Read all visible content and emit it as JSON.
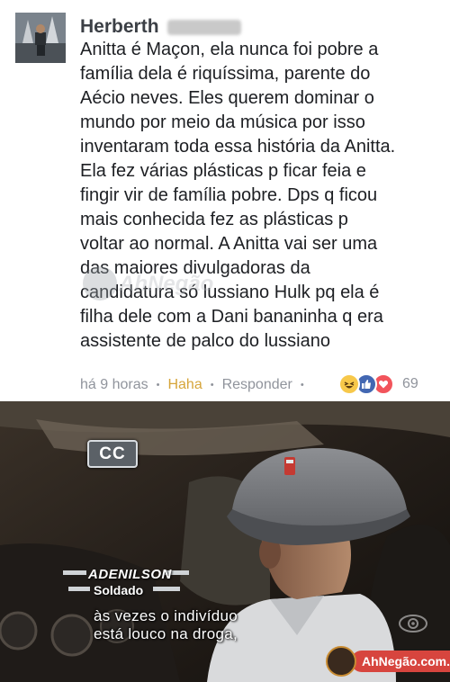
{
  "comment": {
    "author_name": "Herberth",
    "body": "Anitta é Maçon, ela nunca foi pobre a\nfamília dela é riquíssima, parente do\nAécio neves. Eles querem dominar o\nmundo por meio da música por isso\ninventaram toda essa história da Anitta.\nEla fez várias plásticas p ficar feia e\nfingir vir de família pobre. Dps q ficou\nmais conhecida fez as plásticas p\nvoltar ao normal. A Anitta vai ser uma\ndas maiores divulgadoras da\ncandidatura só lussiano Hulk pq ela é\nfilha dele com a Dani bananinha q era\nassistente de palco do lussiano",
    "timestamp": "há 9 horas",
    "reaction_link": "Haha",
    "reply_link": "Responder",
    "reaction_count": "69",
    "reaction_icons": [
      "haha-icon",
      "like-icon",
      "love-icon"
    ],
    "watermark_text": "AhNegão"
  },
  "tv_frame": {
    "cc_badge": "CC",
    "lower_third_name": "ADENILSON",
    "lower_third_role": "Soldado",
    "subtitle": "às vezes o indivíduo\nestá louco na droga,",
    "site_badge": "AhNegão.com.br"
  },
  "colors": {
    "facebook_link_grey": "#90949c",
    "haha_yellow": "#d6a53a",
    "like_blue": "#4267b2",
    "love_red": "#f2545b",
    "site_badge_red": "#d7453e"
  }
}
